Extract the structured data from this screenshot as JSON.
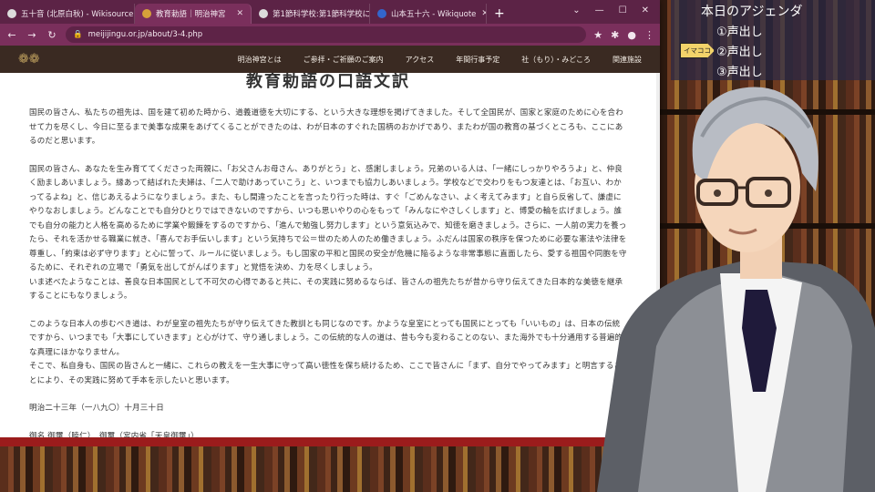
{
  "browser": {
    "tabs": [
      {
        "title": "五十音 (北原白秋) - Wikisource",
        "active": false,
        "favicon_color": "#dcdcdc"
      },
      {
        "title": "教育勅語｜明治神宮",
        "active": true,
        "favicon_color": "#d6a13a"
      },
      {
        "title": "第1節科学校:第1節科学校につい",
        "active": false,
        "favicon_color": "#dcdcdc"
      },
      {
        "title": "山本五十六 - Wikiquote",
        "active": false,
        "favicon_color": "#3366cc"
      }
    ],
    "new_tab": "+",
    "url": "meijijingu.or.jp/about/3-4.php"
  },
  "site": {
    "nav": [
      "明治神宮とは",
      "ご参拝・ご祈願のご案内",
      "アクセス",
      "年間行事予定",
      "社（もり）・みどころ",
      "関連施設"
    ],
    "title": "教育勅語の口語文訳",
    "paragraphs": [
      "国民の皆さん、私たちの祖先は、国を建て初めた時から、道義道徳を大切にする、という大きな理想を掲げてきました。そして全国民が、国家と家庭のために心を合わせて力を尽くし、今日に至るまで美事な成果をあげてくることができたのは、わが日本のすぐれた国柄のおかげであり、またわが国の教育の基づくところも、ここにあるのだと思います。",
      "国民の皆さん、あなたを生み育ててくださった両親に、「お父さんお母さん、ありがとう」と、感謝しましょう。兄弟のいる人は、「一緒にしっかりやろうよ」と、仲良く励ましあいましょう。縁あって結ばれた夫婦は、「二人で助けあっていこう」と、いつまでも協力しあいましょう。学校などで交わりをもつ友達とは、「お互い、わかってるよね」と、信じあえるようになりましょう。また、もし間違ったことを言ったり行った時は、すぐ「ごめんなさい、よく考えてみます」と自ら反省して、謙虚にやりなおしましょう。どんなことでも自分ひとりではできないのですから、いつも思いやりの心をもって「みんなにやさしくします」と、博愛の輪を広げましょう。誰でも自分の能力と人格を高めるために学業や鍛錬をするのですから、「進んで勉強し努力します」という意気込みで、知徳を磨きましょう。さらに、一人前の実力を養ったら、それを活かせる職業に就き、「喜んでお手伝いします」という気持ちで公＝世のため人のため働きましょう。ふだんは国家の秩序を保つために必要な憲法や法律を尊重し、「約束は必ず守ります」と心に誓って、ルールに従いましょう。もし国家の平和と国民の安全が危機に陥るような非常事態に直面したら、愛する祖国や同胞を守るために、それぞれの立場で「勇気を出してがんばります」と覚悟を決め、力を尽くしましょう。\nいま述べたようなことは、善良な日本国民として不可欠の心得であると共に、その実践に努めるならば、皆さんの祖先たちが昔から守り伝えてきた日本的な美徳を継承することにもなりましょう。",
      "このような日本人の歩むべき道は、わが皇室の祖先たちが守り伝えてきた教訓とも同じなのです。かような皇室にとっても国民にとっても「いいもの」は、日本の伝統ですから、いつまでも「大事にしていきます」と心がけて、守り通しましょう。この伝統的な人の道は、昔も今も変わることのない、また海外でも十分通用する普遍的な真理にほかなりません。\nそこで、私自身も、国民の皆さんと一緒に、これらの教えを一生大事に守って高い徳性を保ち続けるため、ここで皆さんに「まず、自分でやってみます」と明言することにより、その実践に努めて手本を示したいと思います。",
      "明治二十三年（一八九〇）十月三十日"
    ],
    "partial_line": "御名 御璽（睦仁）　御璽（宮内省「天皇御璽」）"
  },
  "agenda": {
    "title": "本日のアジェンダ",
    "items": [
      "①声出し",
      "②声出し",
      "③声出し"
    ],
    "marker": "イマココ"
  },
  "colors": {
    "tab_bar": "#5c2346",
    "address_bar": "#7a2f5c",
    "site_header": "#3a2a22",
    "accent_red": "#9b1c1c"
  }
}
